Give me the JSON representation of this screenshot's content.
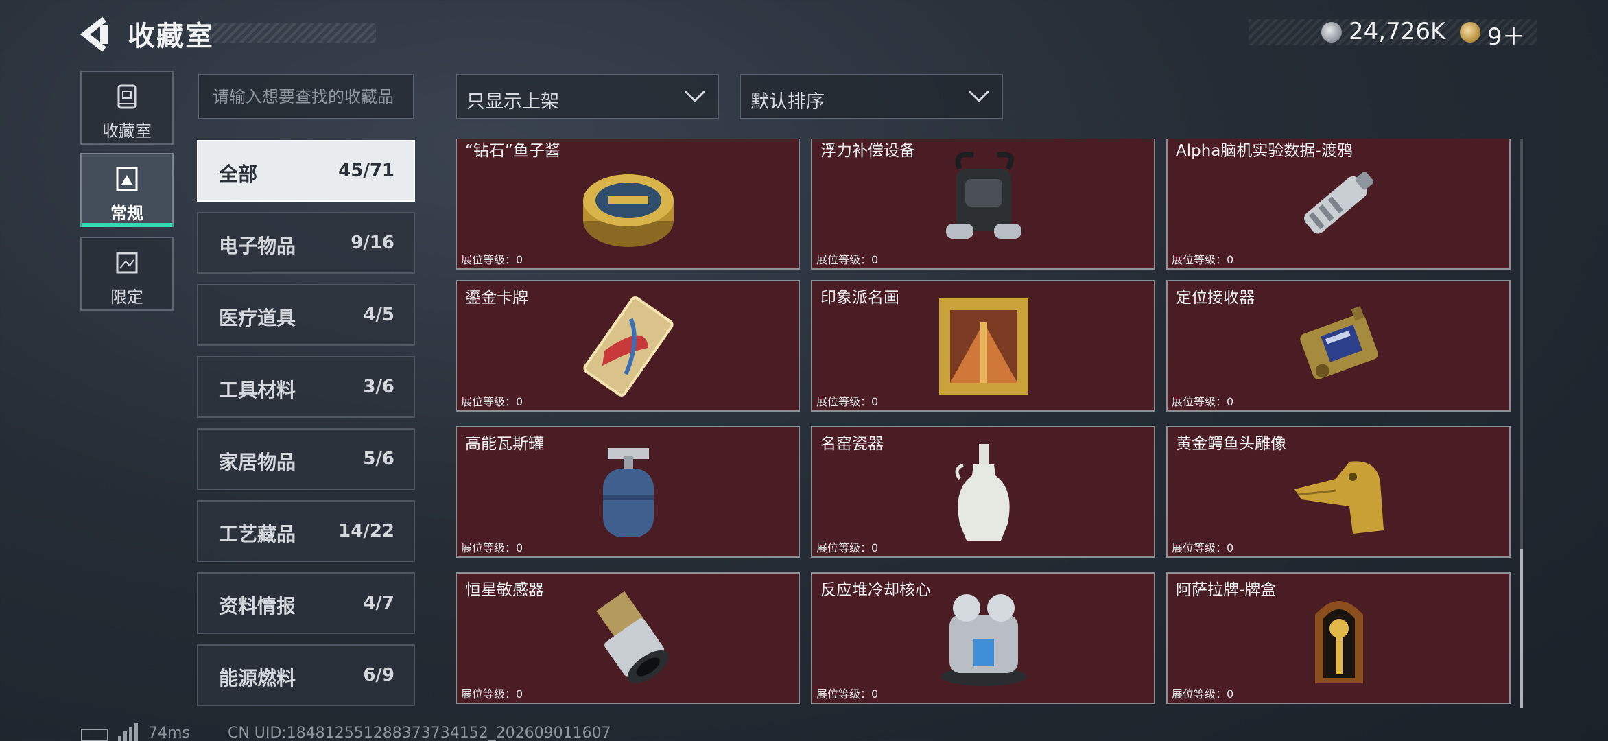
{
  "header": {
    "title": "收藏室",
    "coins": "24,726K",
    "tickets": "9＋"
  },
  "nav": [
    {
      "label": "收藏室",
      "icon": "vault-icon",
      "active": false
    },
    {
      "label": "常规",
      "icon": "frame-icon",
      "active": true
    },
    {
      "label": "限定",
      "icon": "picture-icon",
      "active": false
    }
  ],
  "search": {
    "placeholder": "请输入想要查找的收藏品",
    "value": ""
  },
  "filters": {
    "display": "只显示上架",
    "sort": "默认排序"
  },
  "categories": [
    {
      "name": "全部",
      "count": "45/71",
      "active": true
    },
    {
      "name": "电子物品",
      "count": "9/16",
      "active": false
    },
    {
      "name": "医疗道具",
      "count": "4/5",
      "active": false
    },
    {
      "name": "工具材料",
      "count": "3/6",
      "active": false
    },
    {
      "name": "家居物品",
      "count": "5/6",
      "active": false
    },
    {
      "name": "工艺藏品",
      "count": "14/22",
      "active": false
    },
    {
      "name": "资料情报",
      "count": "4/7",
      "active": false
    },
    {
      "name": "能源燃料",
      "count": "6/9",
      "active": false
    }
  ],
  "level_label": "展位等级：0",
  "items": [
    {
      "name": "“钻石”鱼子酱",
      "icon": "caviar-tin-icon"
    },
    {
      "name": "浮力补偿设备",
      "icon": "buoyancy-device-icon"
    },
    {
      "name": "Alpha脑机实验数据-渡鸦",
      "icon": "data-drive-icon"
    },
    {
      "name": "鎏金卡牌",
      "icon": "gilded-card-icon"
    },
    {
      "name": "印象派名画",
      "icon": "painting-icon"
    },
    {
      "name": "定位接收器",
      "icon": "locator-receiver-icon"
    },
    {
      "name": "高能瓦斯罐",
      "icon": "gas-canister-icon"
    },
    {
      "name": "名窑瓷器",
      "icon": "porcelain-vase-icon"
    },
    {
      "name": "黄金鳄鱼头雕像",
      "icon": "gold-crocodile-icon"
    },
    {
      "name": "恒星敏感器",
      "icon": "star-sensor-icon"
    },
    {
      "name": "反应堆冷却核心",
      "icon": "reactor-core-icon"
    },
    {
      "name": "阿萨拉牌-牌盒",
      "icon": "card-box-icon"
    }
  ],
  "footer": {
    "ping": "74ms",
    "uid": "CN UID:184812551288373734152_202609011607"
  },
  "colors": {
    "accent": "#35d8b0",
    "card_bg": "#4a1d24",
    "card_border": "#8c8f94"
  }
}
